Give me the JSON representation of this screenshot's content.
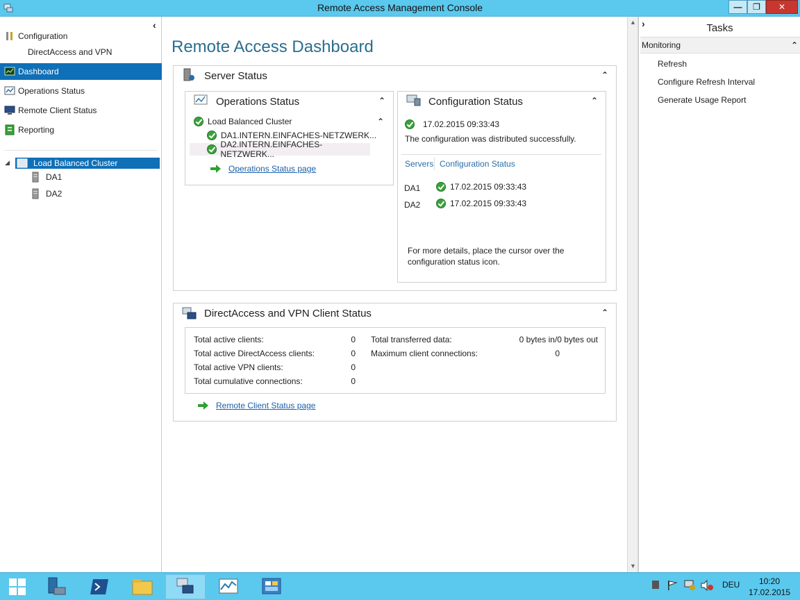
{
  "window": {
    "title": "Remote Access Management Console",
    "buttons": {
      "minimize": "—",
      "restore": "❐",
      "close": "✕"
    }
  },
  "left_nav": {
    "configuration_label": "Configuration",
    "directaccess_vpn_label": "DirectAccess and VPN",
    "dashboard_label": "Dashboard",
    "operations_status_label": "Operations Status",
    "remote_client_status_label": "Remote Client Status",
    "reporting_label": "Reporting",
    "tree": {
      "cluster_label": "Load Balanced Cluster",
      "servers": [
        "DA1",
        "DA2"
      ]
    }
  },
  "main": {
    "dashboard_title": "Remote Access Dashboard",
    "server_status": {
      "title": "Server Status",
      "operations_status": {
        "title": "Operations Status",
        "cluster_label": "Load Balanced Cluster",
        "servers": [
          "DA1.INTERN.EINFACHES-NETZWERK...",
          "DA2.INTERN.EINFACHES-NETZWERK..."
        ],
        "link": "Operations Status page"
      },
      "configuration_status": {
        "title": "Configuration Status",
        "timestamp": "17.02.2015 09:33:43",
        "message": "The configuration was distributed successfully.",
        "col_servers": "Servers",
        "col_status": "Configuration Status",
        "rows": [
          {
            "server": "DA1",
            "status": "17.02.2015 09:33:43"
          },
          {
            "server": "DA2",
            "status": "17.02.2015 09:33:43"
          }
        ],
        "hint_line1": "For more details, place the cursor over the",
        "hint_line2": "configuration status icon."
      }
    },
    "client_status": {
      "title": "DirectAccess and VPN Client Status",
      "left_stats": [
        {
          "label": "Total active clients:",
          "value": "0"
        },
        {
          "label": "Total active DirectAccess clients:",
          "value": "0"
        },
        {
          "label": "Total active VPN clients:",
          "value": "0"
        },
        {
          "label": "Total cumulative connections:",
          "value": "0"
        }
      ],
      "right_stats": [
        {
          "label": "Total transferred data:",
          "value": "0 bytes in/0 bytes out"
        },
        {
          "label": "Maximum client connections:",
          "value": "0"
        }
      ],
      "link": "Remote Client Status page"
    }
  },
  "tasks": {
    "title": "Tasks",
    "section": "Monitoring",
    "items": [
      "Refresh",
      "Configure Refresh Interval",
      "Generate Usage Report"
    ]
  },
  "taskbar": {
    "language": "DEU",
    "time": "10:20",
    "date": "17.02.2015"
  },
  "colors": {
    "titlebar": "#5bc8ee",
    "selection": "#0f6fb7",
    "dashboard_title": "#2a6e8f",
    "link": "#1a5fa8",
    "ok_green": "#3aa23a"
  }
}
